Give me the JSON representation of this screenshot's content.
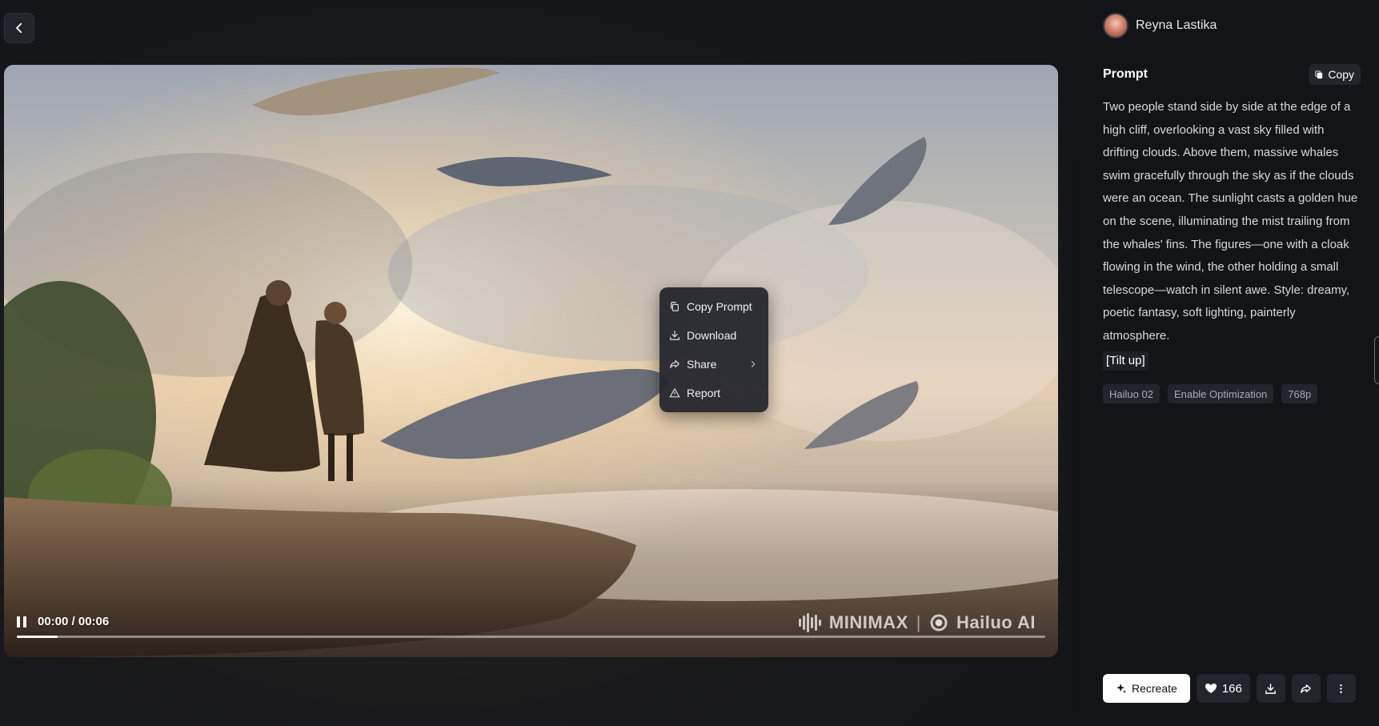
{
  "video": {
    "timecode": "00:00 / 00:06",
    "progress_fraction": 0.04,
    "watermark_brand": "MINIMAX",
    "watermark_separator": "|",
    "watermark_product": "Hailuo AI"
  },
  "context_menu": {
    "items": [
      {
        "label": "Copy Prompt",
        "icon": "copy-icon"
      },
      {
        "label": "Download",
        "icon": "download-icon"
      },
      {
        "label": "Share",
        "icon": "share-icon"
      },
      {
        "label": "Report",
        "icon": "warning-icon"
      }
    ]
  },
  "user": {
    "name": "Reyna Lastika"
  },
  "prompt": {
    "title": "Prompt",
    "copy_label": "Copy",
    "text": "Two people stand side by side at the edge of a high cliff, overlooking a vast sky filled with drifting clouds. Above them, massive whales swim gracefully through the sky as if the clouds were an ocean. The sunlight casts a golden hue on the scene, illuminating the mist trailing from the whales' fins. The figures—one with a cloak flowing in the wind, the other holding a small telescope—watch in silent awe. Style: dreamy, poetic fantasy, soft lighting, painterly atmosphere.",
    "camera_tag": "[Tilt up]",
    "tags": [
      "Hailuo 02",
      "Enable Optimization",
      "768p"
    ]
  },
  "actions": {
    "recreate_label": "Recreate",
    "like_count": "166"
  },
  "colors": {
    "background": "#121418",
    "panel_button": "#22252b",
    "menu_bg": "#26282f",
    "accent": "#ffffff"
  }
}
